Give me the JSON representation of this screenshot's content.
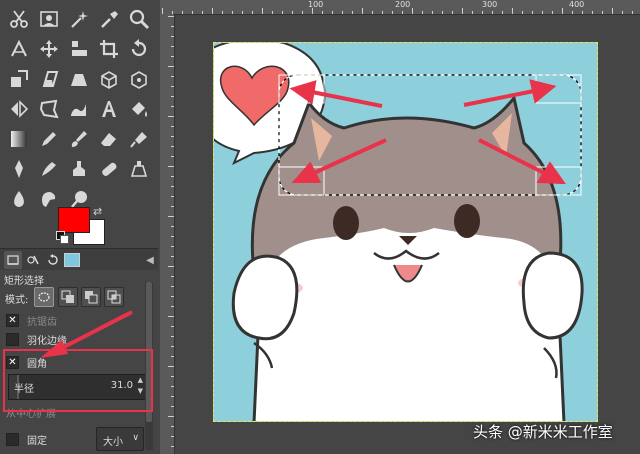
{
  "toolbox": {
    "tools": [
      {
        "id": "scissors",
        "icon": "scissors-icon",
        "col": 0,
        "row": 0
      },
      {
        "id": "fg-select",
        "icon": "foreground-select-icon",
        "col": 1,
        "row": 0
      },
      {
        "id": "fuzzy",
        "icon": "fuzzy-select-icon",
        "col": 2,
        "row": 0
      },
      {
        "id": "color-picker",
        "icon": "color-picker-icon",
        "col": 3,
        "row": 0
      },
      {
        "id": "zoom",
        "icon": "zoom-icon",
        "col": 4,
        "row": 0
      },
      {
        "id": "measure",
        "icon": "measure-icon",
        "col": 0,
        "row": 1
      },
      {
        "id": "move",
        "icon": "move-icon",
        "col": 1,
        "row": 1
      },
      {
        "id": "align",
        "icon": "align-icon",
        "col": 2,
        "row": 1
      },
      {
        "id": "crop",
        "icon": "crop-icon",
        "col": 3,
        "row": 1
      },
      {
        "id": "rotate",
        "icon": "rotate-icon",
        "col": 4,
        "row": 1
      },
      {
        "id": "scale",
        "icon": "scale-icon",
        "col": 0,
        "row": 2
      },
      {
        "id": "shear",
        "icon": "shear-icon",
        "col": 1,
        "row": 2
      },
      {
        "id": "perspective",
        "icon": "perspective-icon",
        "col": 2,
        "row": 2
      },
      {
        "id": "3d-transform",
        "icon": "3d-transform-icon",
        "col": 3,
        "row": 2
      },
      {
        "id": "unified-transform",
        "icon": "unified-transform-icon",
        "col": 4,
        "row": 2
      },
      {
        "id": "flip",
        "icon": "flip-icon",
        "col": 0,
        "row": 3
      },
      {
        "id": "cage",
        "icon": "cage-transform-icon",
        "col": 1,
        "row": 3
      },
      {
        "id": "warp",
        "icon": "warp-transform-icon",
        "col": 2,
        "row": 3
      },
      {
        "id": "text",
        "icon": "text-icon",
        "col": 3,
        "row": 3
      },
      {
        "id": "bucket",
        "icon": "bucket-fill-icon",
        "col": 4,
        "row": 3
      },
      {
        "id": "gradient",
        "icon": "gradient-icon",
        "col": 0,
        "row": 4
      },
      {
        "id": "pencil",
        "icon": "pencil-icon",
        "col": 1,
        "row": 4
      },
      {
        "id": "paintbrush",
        "icon": "paintbrush-icon",
        "col": 2,
        "row": 4
      },
      {
        "id": "eraser",
        "icon": "eraser-icon",
        "col": 3,
        "row": 4
      },
      {
        "id": "airbrush",
        "icon": "airbrush-icon",
        "col": 4,
        "row": 4
      },
      {
        "id": "ink",
        "icon": "ink-icon",
        "col": 0,
        "row": 5
      },
      {
        "id": "mypaint",
        "icon": "mypaint-brush-icon",
        "col": 1,
        "row": 5
      },
      {
        "id": "clone",
        "icon": "clone-icon",
        "col": 2,
        "row": 5
      },
      {
        "id": "heal",
        "icon": "heal-icon",
        "col": 3,
        "row": 5
      },
      {
        "id": "perspective-clone",
        "icon": "perspective-clone-icon",
        "col": 4,
        "row": 5
      },
      {
        "id": "blur",
        "icon": "blur-icon",
        "col": 0,
        "row": 6
      },
      {
        "id": "smudge",
        "icon": "smudge-icon",
        "col": 1,
        "row": 6
      },
      {
        "id": "dodge",
        "icon": "dodge-burn-icon",
        "col": 2,
        "row": 6
      }
    ],
    "foreground_color": "#ff0000",
    "background_color": "#ffffff"
  },
  "tool_options": {
    "title": "矩形选择",
    "mode_label": "模式:",
    "antialias_label": "抗锯齿",
    "feather_label": "羽化边缘",
    "rounded_label": "圆角",
    "radius_label": "半径",
    "radius_value": "31.0",
    "radius_fraction": 0.06,
    "expand_label": "从中心扩展",
    "fixed_label": "固定",
    "fixed_select_value": "大小",
    "fixed_select_arrow": "∨",
    "antialias_checked": "✕",
    "rounded_checked": "✕"
  },
  "ruler": {
    "labels": [
      "100",
      "200",
      "300",
      "400"
    ]
  },
  "annotation_color": "#e8334a",
  "watermark": "头条 @新米米工作室"
}
